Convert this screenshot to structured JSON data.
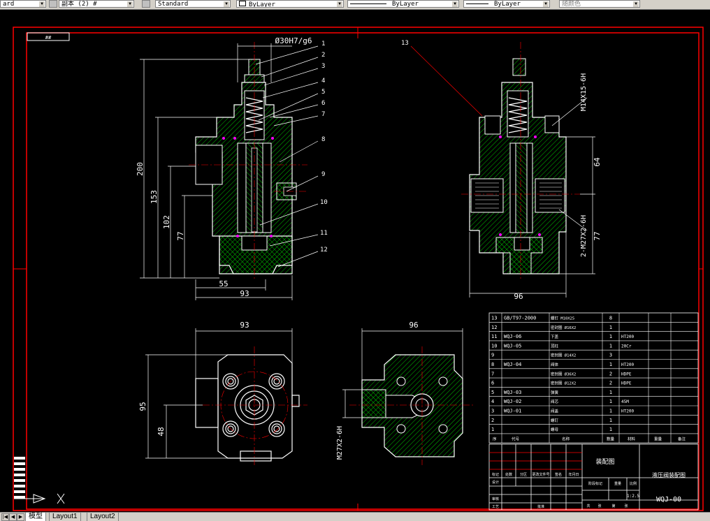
{
  "toolbar": {
    "text_style": "ard",
    "dim_style": "副本 (2) #",
    "table_style": "Standard",
    "layer": "ByLayer",
    "linetype": "ByLayer",
    "lineweight": "ByLayer",
    "color": "随颜色"
  },
  "tabs": {
    "model": "模型",
    "layout1": "Layout1",
    "layout2": "Layout2"
  },
  "drawing": {
    "frame_tag": "##",
    "top_dim": "Ø30H7/g6",
    "callouts": [
      "1",
      "2",
      "3",
      "4",
      "5",
      "6",
      "7",
      "8",
      "9",
      "10",
      "11",
      "12",
      "13"
    ],
    "front_dims": {
      "h200": "200",
      "h153": "153",
      "h102": "102",
      "h77": "77",
      "w55": "55",
      "w93": "93"
    },
    "side_dims": {
      "thread1": "M14X15-6H",
      "h64": "64",
      "thread2": "2-M27X2-6H",
      "h77": "77",
      "w96": "96"
    },
    "top_dims": {
      "w93": "93",
      "h95": "95",
      "h48": "48"
    },
    "bottom_dims": {
      "w96": "96",
      "thread": "M27X2-6H"
    }
  },
  "bom": {
    "rows": [
      {
        "no": "13",
        "code": "GB/T97-2000",
        "name": "螺钉 M10X25",
        "qty": "8",
        "mat": ""
      },
      {
        "no": "12",
        "code": "",
        "name": "密封圈 Ø16X2",
        "qty": "1",
        "mat": ""
      },
      {
        "no": "11",
        "code": "WQJ-06",
        "name": "下盖",
        "qty": "1",
        "mat": "HT200"
      },
      {
        "no": "10",
        "code": "WQJ-05",
        "name": "顶柱",
        "qty": "1",
        "mat": "20Cr"
      },
      {
        "no": "9",
        "code": "",
        "name": "密封圈 Ø14X2",
        "qty": "3",
        "mat": ""
      },
      {
        "no": "8",
        "code": "WQJ-04",
        "name": "阀体",
        "qty": "1",
        "mat": "HT200"
      },
      {
        "no": "7",
        "code": "",
        "name": "密封圈 Ø36X2",
        "qty": "2",
        "mat": "HDPE"
      },
      {
        "no": "6",
        "code": "",
        "name": "密封圈 Ø12X2",
        "qty": "2",
        "mat": "HDPE"
      },
      {
        "no": "5",
        "code": "WQJ-03",
        "name": "弹簧",
        "qty": "1",
        "mat": ""
      },
      {
        "no": "4",
        "code": "WQJ-02",
        "name": "阀芯",
        "qty": "1",
        "mat": "45M"
      },
      {
        "no": "3",
        "code": "WQJ-01",
        "name": "阀盖",
        "qty": "1",
        "mat": "HT200"
      },
      {
        "no": "2",
        "code": "",
        "name": "螺钉",
        "qty": "1",
        "mat": ""
      },
      {
        "no": "1",
        "code": "",
        "name": "螺母",
        "qty": "1",
        "mat": ""
      }
    ],
    "header": {
      "no": "序",
      "code": "代号",
      "name": "名称",
      "qty": "数量",
      "mat": "材料",
      "mass": "重量",
      "note": "备注"
    }
  },
  "title_block": {
    "title": "装配图",
    "name": "液压阀装配图",
    "scale": "1:2.5",
    "drawing_no": "WQJ-00",
    "rows": [
      "标记",
      "处数",
      "分区",
      "更改文件号",
      "签名",
      "年月日"
    ],
    "roles": [
      "设计",
      "审核",
      "工艺",
      "批准"
    ],
    "stage_labels": [
      "阶段标记",
      "重量",
      "比例"
    ],
    "sheet_labels": [
      "共",
      "张",
      "第",
      "张"
    ]
  },
  "colors": {
    "background": "#000000",
    "frame": "#ff0000",
    "outline": "#ffffff",
    "hatch": "#00c000",
    "hidden": "#ff00ff",
    "dim": "#ffffff"
  }
}
